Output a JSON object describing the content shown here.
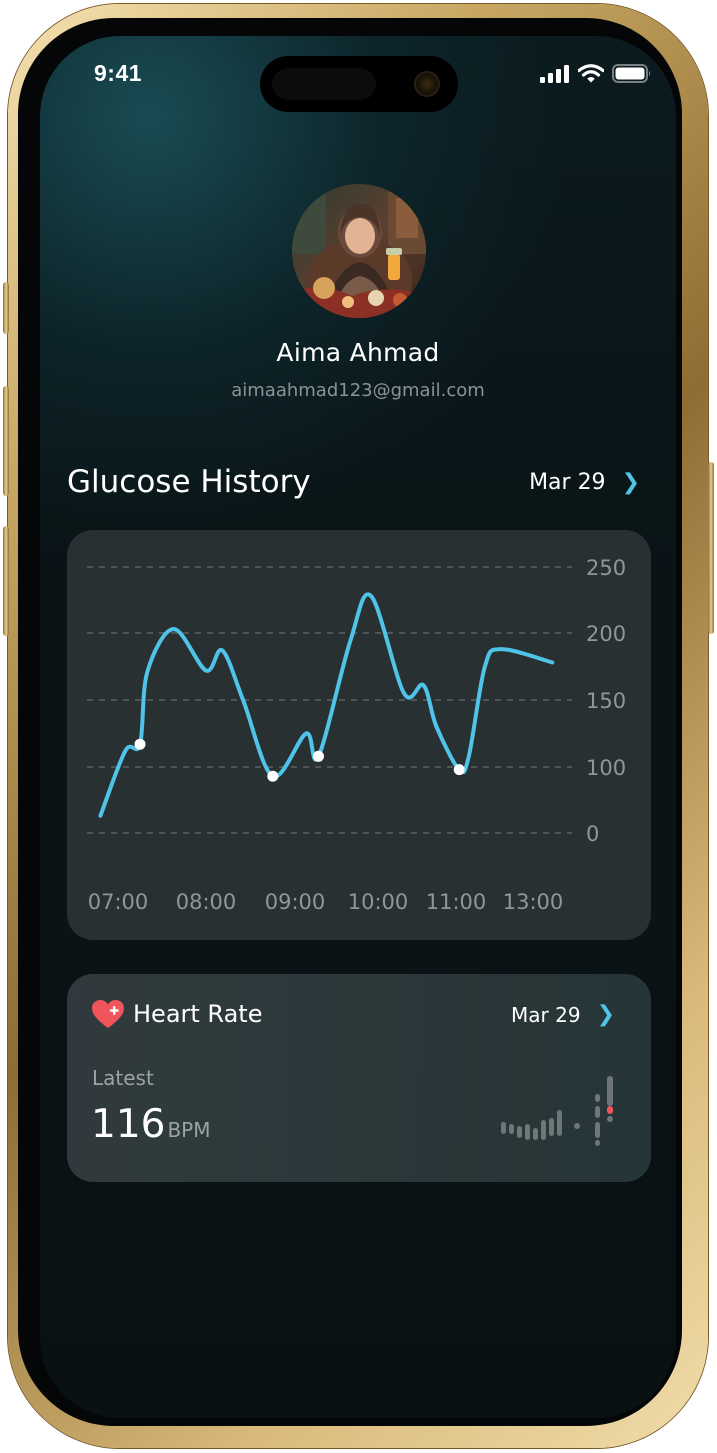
{
  "status_bar": {
    "time": "9:41",
    "icons": [
      "signal-icon",
      "wifi-icon",
      "battery-icon"
    ]
  },
  "profile": {
    "name": "Aima Ahmad",
    "email": "aimaahmad123@gmail.com",
    "avatar": "profile-photo"
  },
  "glucose": {
    "title": "Glucose History",
    "date": "Mar 29",
    "chevron_icon": "chevron-right-icon"
  },
  "chart_data": {
    "type": "line",
    "y_tick_labels": [
      "250",
      "200",
      "150",
      "100",
      "0"
    ],
    "x_tick_labels": [
      "07:00",
      "08:00",
      "09:00",
      "10:00",
      "11:00",
      "13:00"
    ],
    "grid": "dashed horizontal",
    "line_color": "#4fc3e8",
    "series": [
      {
        "points": [
          {
            "x": "06:48",
            "y": 63
          },
          {
            "x": "07:05",
            "y": 112
          },
          {
            "x": "07:15",
            "y": 117
          },
          {
            "x": "07:20",
            "y": 171
          },
          {
            "x": "07:38",
            "y": 203
          },
          {
            "x": "08:00",
            "y": 172
          },
          {
            "x": "08:11",
            "y": 187
          },
          {
            "x": "08:25",
            "y": 150
          },
          {
            "x": "08:45",
            "y": 93
          },
          {
            "x": "09:08",
            "y": 125
          },
          {
            "x": "09:17",
            "y": 108
          },
          {
            "x": "09:40",
            "y": 194
          },
          {
            "x": "09:55",
            "y": 228
          },
          {
            "x": "10:20",
            "y": 155
          },
          {
            "x": "10:35",
            "y": 161
          },
          {
            "x": "10:45",
            "y": 130
          },
          {
            "x": "11:05",
            "y": 98
          },
          {
            "x": "11:20",
            "y": 108
          },
          {
            "x": "11:45",
            "y": 175
          },
          {
            "x": "12:10",
            "y": 188
          },
          {
            "x": "13:30",
            "y": 178
          }
        ],
        "marked_points": [
          {
            "x": "07:15",
            "y": 117
          },
          {
            "x": "08:45",
            "y": 93
          },
          {
            "x": "09:17",
            "y": 108
          },
          {
            "x": "11:05",
            "y": 98
          }
        ]
      }
    ]
  },
  "heart_rate": {
    "title": "Heart Rate",
    "date": "Mar 29",
    "latest_label": "Latest",
    "value": "116",
    "unit": "BPM",
    "heart_icon": "heart-plus-icon",
    "accent_color": "#f2545b"
  }
}
